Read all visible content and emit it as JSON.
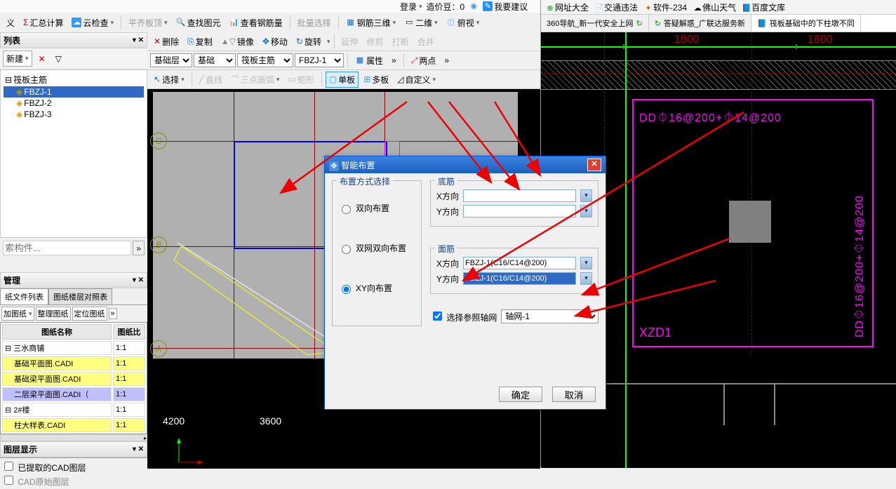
{
  "top": {
    "login": "登录",
    "price": "造价豆：0",
    "suggest": "我要建议",
    "links": [
      "网址大全",
      "交通违法",
      "软件-234",
      "佛山天气",
      "百度文库"
    ]
  },
  "tb1": {
    "yi": "义",
    "sum": "汇总计算",
    "cloud": "云检查",
    "flat": "平齐板顶",
    "find": "查找图元",
    "steel": "查看钢筋量",
    "batch": "批量选择",
    "steel3d": "钢筋三维",
    "d2": "二维",
    "view": "俯视"
  },
  "tb2": {
    "del": "删除",
    "copy": "复制",
    "mirror": "镜像",
    "move": "移动",
    "rotate": "旋转",
    "extend": "延伸",
    "trim": "修剪",
    "break": "打断",
    "merge": "合并"
  },
  "tb3": {
    "layer": "基础层",
    "type": "基础",
    "sub": "筏板主筋",
    "code": "FBZJ-1",
    "prop": "属性",
    "two": "两点"
  },
  "tb4": {
    "sel": "选择",
    "line": "直线",
    "arc": "三点画弧",
    "rect": "矩形",
    "single": "单板",
    "multi": "多板",
    "custom": "自定义"
  },
  "left": {
    "list": "列表",
    "new": "新建",
    "root": "筏板主筋",
    "items": [
      "FBZJ-1",
      "FBZJ-2",
      "FBZJ-3"
    ],
    "search_ph": "索构件...",
    "mgmt": "管理",
    "tabs": [
      "纸文件列表",
      "图纸楼层对照表"
    ],
    "dwgbar": [
      "加图纸",
      "整理图纸",
      "定位图纸"
    ],
    "tblhdr": [
      "图纸名称",
      "图纸比"
    ],
    "rows": [
      {
        "n": "三水商铺",
        "r": "1:1",
        "y": false,
        "exp": "-"
      },
      {
        "n": "基础平面图.CADI",
        "r": "1:1",
        "y": true
      },
      {
        "n": "基础梁平面图.CADI",
        "r": "1:1",
        "y": true
      },
      {
        "n": "二层梁平面图.CADI（",
        "r": "1:1",
        "y": false,
        "sel": true
      },
      {
        "n": "2#楼",
        "r": "1:1",
        "y": false,
        "exp": "-"
      },
      {
        "n": "柱大样表.CADI",
        "r": "1:1",
        "y": true
      }
    ],
    "layer": "图层显示",
    "cadlayer": "已提取的CAD图层",
    "orig": "CAD原始图层"
  },
  "cad": {
    "axes": [
      "A",
      "B",
      "C"
    ],
    "dims": [
      "4200",
      "3600"
    ]
  },
  "dlg": {
    "title": "智能布置",
    "method": "布置方式选择",
    "r1": "双向布置",
    "r2": "双网双向布置",
    "r3": "XY向布置",
    "bottom": "底筋",
    "top": "面筋",
    "x": "X方向",
    "y": "Y方向",
    "val": "FBZJ-1(C16/C14@200)",
    "chk": "选择参照轴网",
    "axis": "轴网-1",
    "ok": "确定",
    "cancel": "取消"
  },
  "browser": {
    "tabs": [
      "360导航_新一代安全上网",
      "答疑解惑_广联达服务新",
      "筏板基础中的下柱墩不同"
    ]
  },
  "rcad": {
    "dim": "1800",
    "anno": "DD⏀16@200+⏀14@200",
    "zone": "XZD1"
  }
}
